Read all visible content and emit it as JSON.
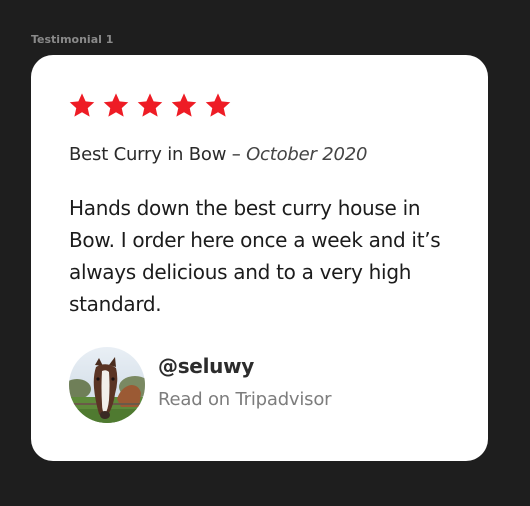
{
  "frame": {
    "label": "Testimonial 1"
  },
  "testimonial": {
    "rating": 5,
    "rating_max": 5,
    "star_color": "#ee1c25",
    "title": "Best Curry in Bow",
    "separator": " – ",
    "date": "October 2020",
    "quote": "Hands down the best curry house in Bow. I order here once a week and it’s always delicious and to a very high standard.",
    "author_handle": "@seluwy",
    "source_link": "Read on Tripadvisor",
    "avatar_icon": "horse-photo-avatar"
  }
}
